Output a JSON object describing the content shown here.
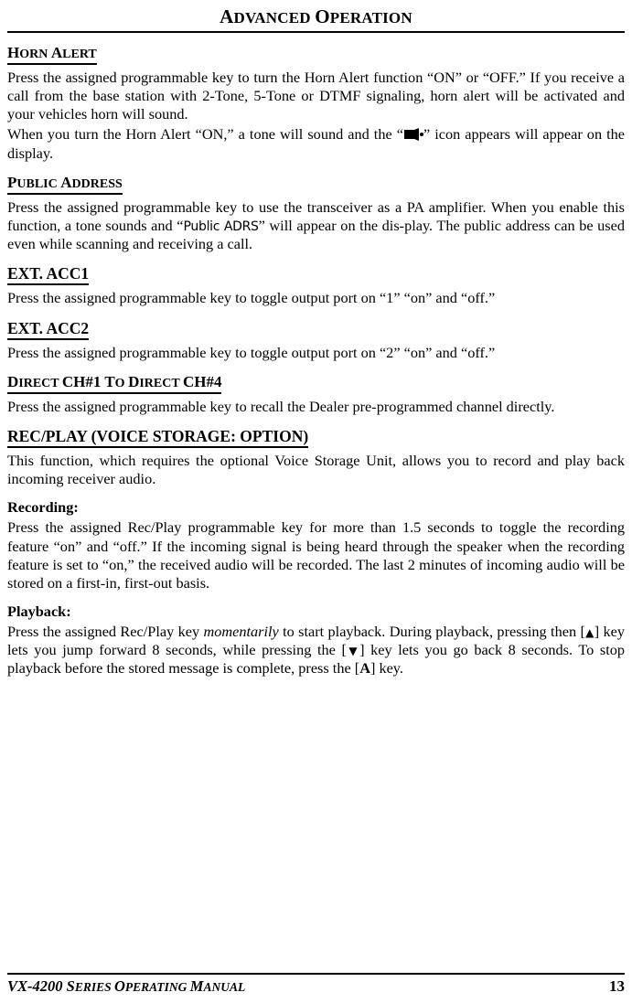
{
  "header": {
    "title_first": "A",
    "title_rest": "DVANCED ",
    "title_first2": "O",
    "title_rest2": "PERATION"
  },
  "sections": [
    {
      "id": "horn-alert",
      "heading_cap": "H",
      "heading_sc": "ORN ",
      "heading_cap2": "A",
      "heading_sc2": "LERT",
      "paragraphs": [
        "Press the assigned programmable key to turn the Horn Alert function “ON” or “OFF.” If you receive a call from the base station with 2-Tone, 5-Tone or DTMF signaling, horn alert will be activated and your vehicles horn will sound.",
        "When you turn the Horn Alert “ON,” a tone will sound and the “",
        "” icon appears will appear on the display."
      ]
    },
    {
      "id": "public-address",
      "heading_cap": "P",
      "heading_sc": "UBLIC ",
      "heading_cap2": "A",
      "heading_sc2": "DDRESS",
      "para_a": "Press the assigned programmable key to use the transceiver as a PA amplifier. When you enable this function, a tone sounds and “",
      "lcd_text": "Public ADRS",
      "para_b": "” will appear on the dis-play. The public address can be used even while scanning and receiving a call."
    },
    {
      "id": "ext-acc1",
      "heading": "EXT. ACC1",
      "paragraph": "Press the assigned programmable key to toggle output port on “1” “on” and “off.”"
    },
    {
      "id": "ext-acc2",
      "heading": "EXT. ACC2",
      "paragraph": "Press the assigned programmable key to toggle output port on “2” “on” and “off.”"
    },
    {
      "id": "direct-ch",
      "heading_cap": "D",
      "heading_sc": "IRECT ",
      "heading_mid": "CH#1 ",
      "heading_cap2": "T",
      "heading_sc2": "O ",
      "heading_cap3": "D",
      "heading_sc3": "IRECT ",
      "heading_end": "CH#4",
      "paragraph": "Press the assigned programmable key to recall the Dealer pre-programmed channel directly."
    },
    {
      "id": "rec-play",
      "heading_main": "REC/PLAY (",
      "heading_cap": "V",
      "heading_sc": "OICE ",
      "heading_cap2": "S",
      "heading_sc2": "TORAGE: ",
      "heading_cap3": "O",
      "heading_sc3": "PTION",
      "heading_end": ")",
      "paragraph": "This function, which requires the optional Voice Storage Unit, allows you to record and play back incoming receiver audio.",
      "sub1_label": "Recording:",
      "sub1_paragraph": "Press the assigned Rec/Play programmable key for more than 1.5 seconds to toggle the recording feature “on” and “off.” If the incoming signal is being heard through the speaker when the recording feature is set to “on,” the received audio will be recorded. The last 2 minutes of incoming audio will be stored on a first-in, first-out basis.",
      "sub2_label": "Playback:",
      "sub2_a": "Press the assigned Rec/Play key ",
      "sub2_ital": "momentarily",
      "sub2_b": " to start playback. During playback, pressing then [",
      "sub2_key_up": "▲",
      "sub2_c": "] key lets you jump forward 8 seconds, while pressing the [",
      "sub2_key_dn": "▼",
      "sub2_d": "] key lets you go back 8 seconds. To stop playback before the stored message is complete, press the [",
      "sub2_key_a": "A",
      "sub2_e": "] key."
    }
  ],
  "footer": {
    "manual_cap1": "VX-4200 S",
    "manual_sc1": "ERIES ",
    "manual_cap2": "O",
    "manual_sc2": "PERATING ",
    "manual_cap3": "M",
    "manual_sc3": "ANUAL",
    "page_number": "13"
  }
}
